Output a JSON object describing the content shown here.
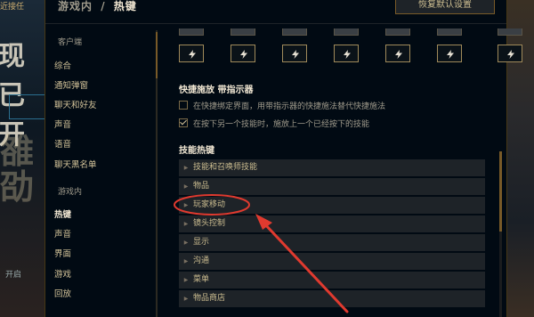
{
  "background": {
    "left_top": "近接任",
    "left_big": "现已开",
    "left_big2": "雒\n劭",
    "left_bottom": "开启"
  },
  "header": {
    "section": "游戏内",
    "separator": "/",
    "title": "热键",
    "reset_label": "恢复默认设置"
  },
  "sidebar": {
    "client_label": "客户端",
    "client_items": [
      "综合",
      "通知弹窗",
      "聊天和好友",
      "声音",
      "语音",
      "聊天黑名单"
    ],
    "ingame_label": "游戏内",
    "ingame_items": [
      "热键",
      "声音",
      "界面",
      "游戏",
      "回放"
    ],
    "active": "热键"
  },
  "keys": {
    "icon": "lightning-bolt-icon",
    "count": 7
  },
  "quickcast": {
    "title": "快捷施放 带指示器",
    "options": [
      {
        "label": "在快捷绑定界面，用带指示器的快捷施法替代快捷施法",
        "checked": false
      },
      {
        "label": "在按下另一个技能时，施放上一个已经按下的技能",
        "checked": true
      }
    ]
  },
  "skill_hotkeys": {
    "title": "技能热键",
    "categories": [
      "技能和召唤师技能",
      "物品",
      "玩家移动",
      "镜头控制",
      "显示",
      "沟通",
      "菜单",
      "物品商店"
    ]
  },
  "annotation": {
    "color": "#e03a2f",
    "highlighted": "玩家移动"
  },
  "colors": {
    "gold": "#c8aa6e",
    "panel": "#010a13",
    "row": "#1e2328"
  }
}
